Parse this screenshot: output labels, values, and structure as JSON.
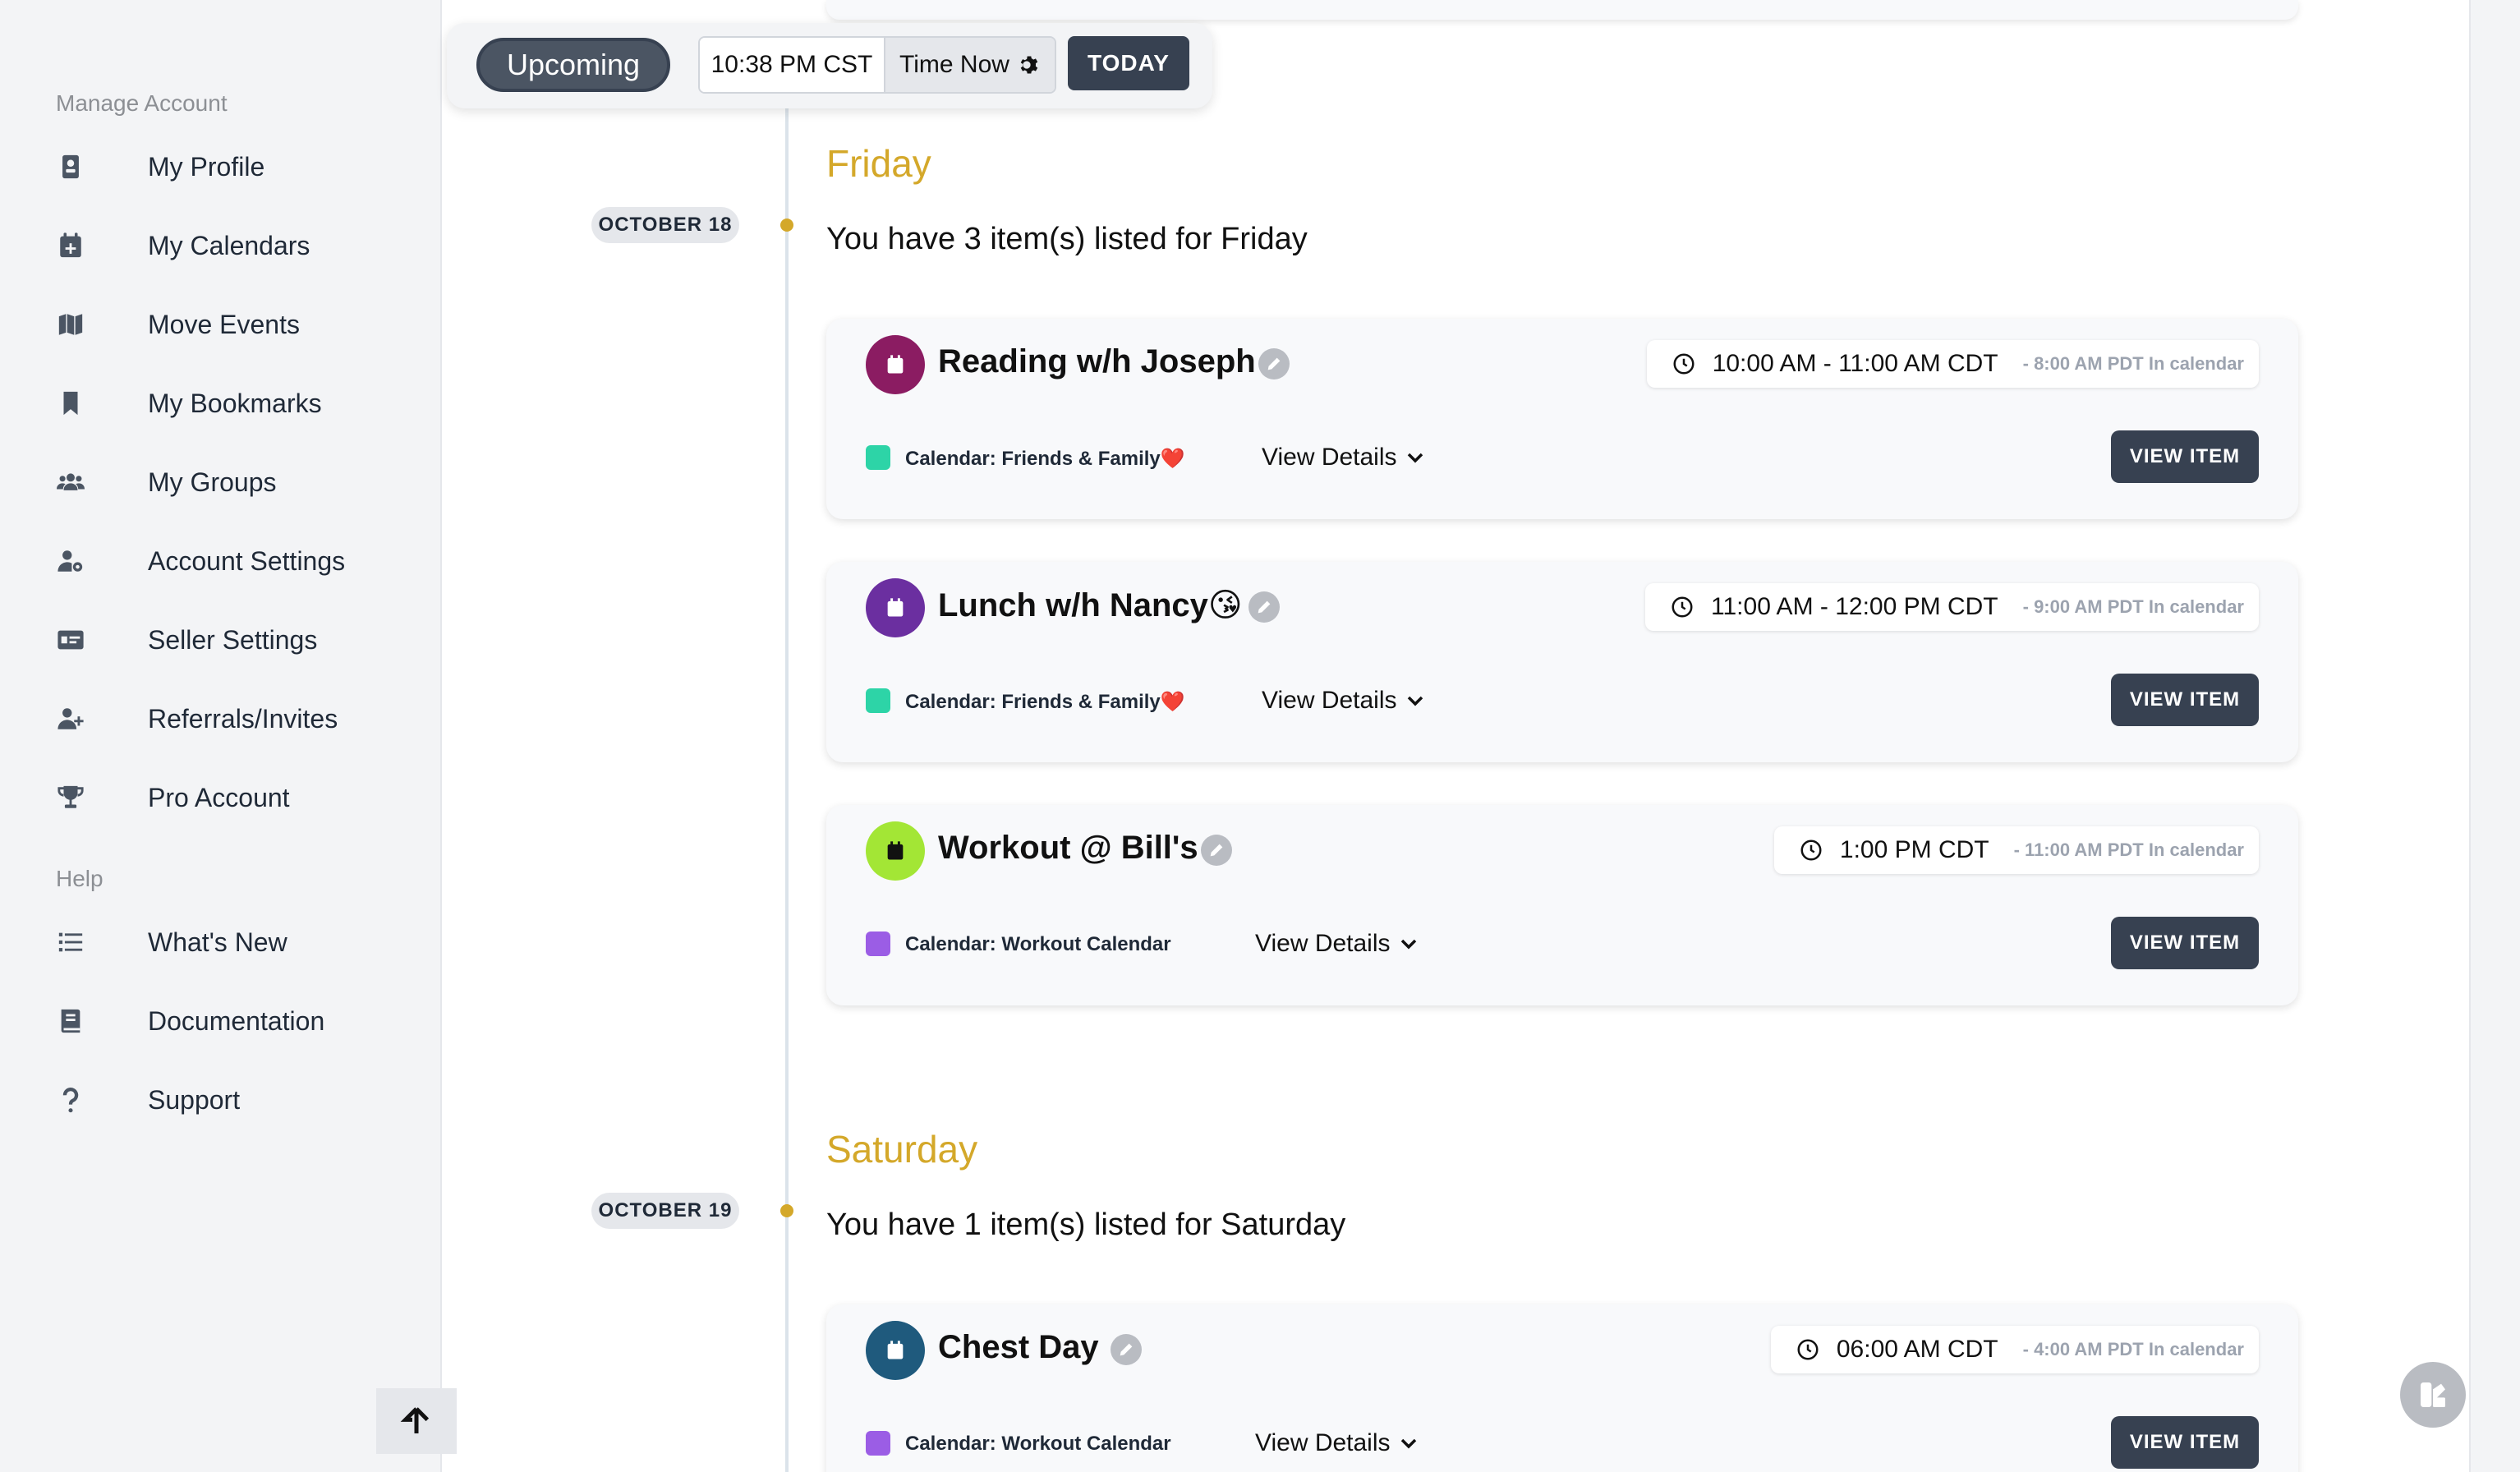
{
  "sidebar": {
    "manage_label": "Manage Account",
    "help_label": "Help",
    "items": [
      {
        "label": "My Profile",
        "icon": "id-badge-icon"
      },
      {
        "label": "My Calendars",
        "icon": "calendar-plus-icon"
      },
      {
        "label": "Move Events",
        "icon": "map-icon"
      },
      {
        "label": "My Bookmarks",
        "icon": "bookmark-icon"
      },
      {
        "label": "My Groups",
        "icon": "users-icon"
      },
      {
        "label": "Account Settings",
        "icon": "user-cog-icon"
      },
      {
        "label": "Seller Settings",
        "icon": "money-card-icon"
      },
      {
        "label": "Referrals/Invites",
        "icon": "user-plus-icon"
      },
      {
        "label": "Pro Account",
        "icon": "trophy-icon"
      }
    ],
    "help_items": [
      {
        "label": "What's New",
        "icon": "list-icon"
      },
      {
        "label": "Documentation",
        "icon": "book-icon"
      },
      {
        "label": "Support",
        "icon": "question-icon"
      }
    ]
  },
  "toolbar": {
    "upcoming": "Upcoming",
    "time_value": "10:38 PM CST",
    "time_now": "Time Now",
    "today": "TODAY"
  },
  "days": [
    {
      "date": "OCTOBER 18",
      "title": "Friday",
      "summary": "You have 3 item(s) listed for Friday",
      "events": [
        {
          "title": "Reading w/h Joseph",
          "icon_color": "#8b1c62",
          "time": "10:00 AM - 11:00 AM CDT",
          "sub_time": "- 8:00 AM PDT In calendar",
          "calendar": "Calendar: Friends & Family❤️",
          "calendar_color": "#2dd4a7",
          "details": "View Details",
          "button": "VIEW ITEM"
        },
        {
          "title": "Lunch w/h Nancy😘",
          "icon_color": "#6b2fa0",
          "time": "11:00 AM - 12:00 PM CDT",
          "sub_time": "- 9:00 AM PDT In calendar",
          "calendar": "Calendar: Friends & Family❤️",
          "calendar_color": "#2dd4a7",
          "details": "View Details",
          "button": "VIEW ITEM"
        },
        {
          "title": "Workout @ Bill's",
          "icon_color": "#a3e635",
          "time": "1:00 PM CDT",
          "sub_time": "- 11:00 AM PDT In calendar",
          "calendar": "Calendar: Workout Calendar",
          "calendar_color": "#9b5de5",
          "details": "View Details",
          "button": "VIEW ITEM"
        }
      ]
    },
    {
      "date": "OCTOBER 19",
      "title": "Saturday",
      "summary": "You have 1 item(s) listed for Saturday",
      "events": [
        {
          "title": "Chest Day",
          "icon_color": "#1f5a7d",
          "time": "06:00 AM CDT",
          "sub_time": "- 4:00 AM PDT In calendar",
          "calendar": "Calendar: Workout Calendar",
          "calendar_color": "#9b5de5",
          "details": "View Details",
          "button": "VIEW ITEM"
        }
      ]
    }
  ]
}
